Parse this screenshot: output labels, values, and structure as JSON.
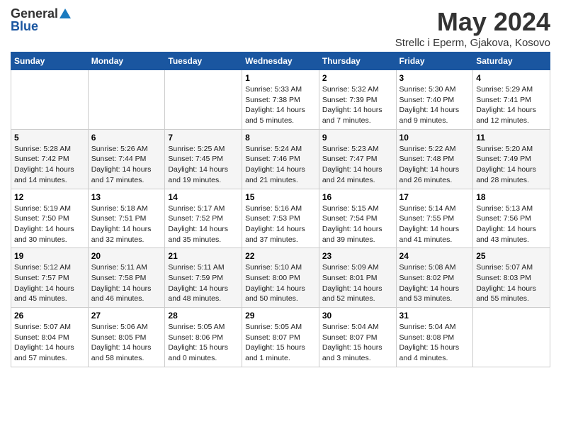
{
  "logo": {
    "general": "General",
    "blue": "Blue"
  },
  "title": {
    "month": "May 2024",
    "location": "Strellc i Eperm, Gjakova, Kosovo"
  },
  "weekdays": [
    "Sunday",
    "Monday",
    "Tuesday",
    "Wednesday",
    "Thursday",
    "Friday",
    "Saturday"
  ],
  "weeks": [
    [
      {
        "day": null
      },
      {
        "day": null
      },
      {
        "day": null
      },
      {
        "day": "1",
        "sunrise": "Sunrise: 5:33 AM",
        "sunset": "Sunset: 7:38 PM",
        "daylight": "Daylight: 14 hours and 5 minutes."
      },
      {
        "day": "2",
        "sunrise": "Sunrise: 5:32 AM",
        "sunset": "Sunset: 7:39 PM",
        "daylight": "Daylight: 14 hours and 7 minutes."
      },
      {
        "day": "3",
        "sunrise": "Sunrise: 5:30 AM",
        "sunset": "Sunset: 7:40 PM",
        "daylight": "Daylight: 14 hours and 9 minutes."
      },
      {
        "day": "4",
        "sunrise": "Sunrise: 5:29 AM",
        "sunset": "Sunset: 7:41 PM",
        "daylight": "Daylight: 14 hours and 12 minutes."
      }
    ],
    [
      {
        "day": "5",
        "sunrise": "Sunrise: 5:28 AM",
        "sunset": "Sunset: 7:42 PM",
        "daylight": "Daylight: 14 hours and 14 minutes."
      },
      {
        "day": "6",
        "sunrise": "Sunrise: 5:26 AM",
        "sunset": "Sunset: 7:44 PM",
        "daylight": "Daylight: 14 hours and 17 minutes."
      },
      {
        "day": "7",
        "sunrise": "Sunrise: 5:25 AM",
        "sunset": "Sunset: 7:45 PM",
        "daylight": "Daylight: 14 hours and 19 minutes."
      },
      {
        "day": "8",
        "sunrise": "Sunrise: 5:24 AM",
        "sunset": "Sunset: 7:46 PM",
        "daylight": "Daylight: 14 hours and 21 minutes."
      },
      {
        "day": "9",
        "sunrise": "Sunrise: 5:23 AM",
        "sunset": "Sunset: 7:47 PM",
        "daylight": "Daylight: 14 hours and 24 minutes."
      },
      {
        "day": "10",
        "sunrise": "Sunrise: 5:22 AM",
        "sunset": "Sunset: 7:48 PM",
        "daylight": "Daylight: 14 hours and 26 minutes."
      },
      {
        "day": "11",
        "sunrise": "Sunrise: 5:20 AM",
        "sunset": "Sunset: 7:49 PM",
        "daylight": "Daylight: 14 hours and 28 minutes."
      }
    ],
    [
      {
        "day": "12",
        "sunrise": "Sunrise: 5:19 AM",
        "sunset": "Sunset: 7:50 PM",
        "daylight": "Daylight: 14 hours and 30 minutes."
      },
      {
        "day": "13",
        "sunrise": "Sunrise: 5:18 AM",
        "sunset": "Sunset: 7:51 PM",
        "daylight": "Daylight: 14 hours and 32 minutes."
      },
      {
        "day": "14",
        "sunrise": "Sunrise: 5:17 AM",
        "sunset": "Sunset: 7:52 PM",
        "daylight": "Daylight: 14 hours and 35 minutes."
      },
      {
        "day": "15",
        "sunrise": "Sunrise: 5:16 AM",
        "sunset": "Sunset: 7:53 PM",
        "daylight": "Daylight: 14 hours and 37 minutes."
      },
      {
        "day": "16",
        "sunrise": "Sunrise: 5:15 AM",
        "sunset": "Sunset: 7:54 PM",
        "daylight": "Daylight: 14 hours and 39 minutes."
      },
      {
        "day": "17",
        "sunrise": "Sunrise: 5:14 AM",
        "sunset": "Sunset: 7:55 PM",
        "daylight": "Daylight: 14 hours and 41 minutes."
      },
      {
        "day": "18",
        "sunrise": "Sunrise: 5:13 AM",
        "sunset": "Sunset: 7:56 PM",
        "daylight": "Daylight: 14 hours and 43 minutes."
      }
    ],
    [
      {
        "day": "19",
        "sunrise": "Sunrise: 5:12 AM",
        "sunset": "Sunset: 7:57 PM",
        "daylight": "Daylight: 14 hours and 45 minutes."
      },
      {
        "day": "20",
        "sunrise": "Sunrise: 5:11 AM",
        "sunset": "Sunset: 7:58 PM",
        "daylight": "Daylight: 14 hours and 46 minutes."
      },
      {
        "day": "21",
        "sunrise": "Sunrise: 5:11 AM",
        "sunset": "Sunset: 7:59 PM",
        "daylight": "Daylight: 14 hours and 48 minutes."
      },
      {
        "day": "22",
        "sunrise": "Sunrise: 5:10 AM",
        "sunset": "Sunset: 8:00 PM",
        "daylight": "Daylight: 14 hours and 50 minutes."
      },
      {
        "day": "23",
        "sunrise": "Sunrise: 5:09 AM",
        "sunset": "Sunset: 8:01 PM",
        "daylight": "Daylight: 14 hours and 52 minutes."
      },
      {
        "day": "24",
        "sunrise": "Sunrise: 5:08 AM",
        "sunset": "Sunset: 8:02 PM",
        "daylight": "Daylight: 14 hours and 53 minutes."
      },
      {
        "day": "25",
        "sunrise": "Sunrise: 5:07 AM",
        "sunset": "Sunset: 8:03 PM",
        "daylight": "Daylight: 14 hours and 55 minutes."
      }
    ],
    [
      {
        "day": "26",
        "sunrise": "Sunrise: 5:07 AM",
        "sunset": "Sunset: 8:04 PM",
        "daylight": "Daylight: 14 hours and 57 minutes."
      },
      {
        "day": "27",
        "sunrise": "Sunrise: 5:06 AM",
        "sunset": "Sunset: 8:05 PM",
        "daylight": "Daylight: 14 hours and 58 minutes."
      },
      {
        "day": "28",
        "sunrise": "Sunrise: 5:05 AM",
        "sunset": "Sunset: 8:06 PM",
        "daylight": "Daylight: 15 hours and 0 minutes."
      },
      {
        "day": "29",
        "sunrise": "Sunrise: 5:05 AM",
        "sunset": "Sunset: 8:07 PM",
        "daylight": "Daylight: 15 hours and 1 minute."
      },
      {
        "day": "30",
        "sunrise": "Sunrise: 5:04 AM",
        "sunset": "Sunset: 8:07 PM",
        "daylight": "Daylight: 15 hours and 3 minutes."
      },
      {
        "day": "31",
        "sunrise": "Sunrise: 5:04 AM",
        "sunset": "Sunset: 8:08 PM",
        "daylight": "Daylight: 15 hours and 4 minutes."
      },
      {
        "day": null
      }
    ]
  ]
}
